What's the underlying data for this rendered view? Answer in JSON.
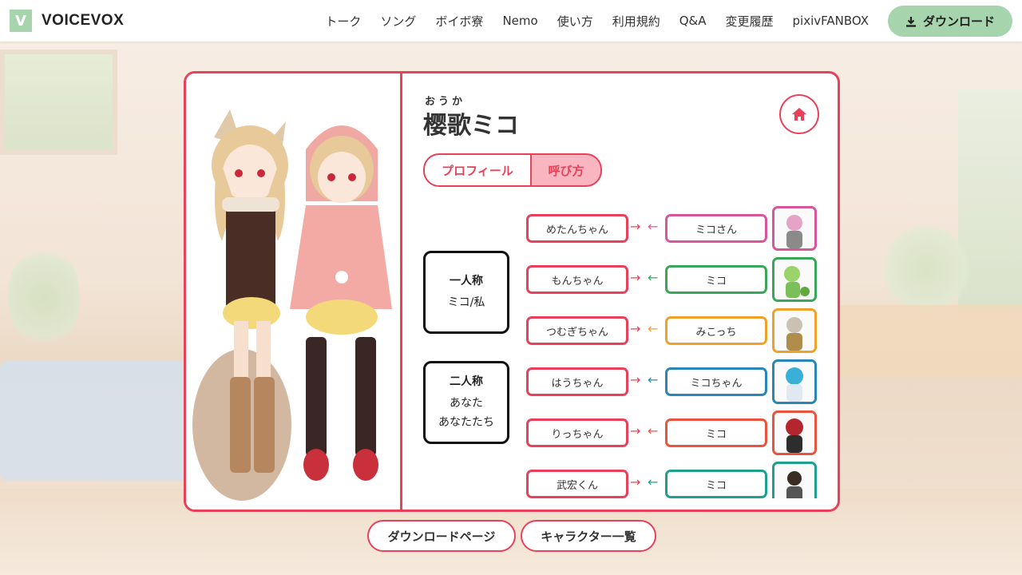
{
  "header": {
    "logo_mark": "V",
    "logo_text": "VOICEVOX",
    "nav": [
      "トーク",
      "ソング",
      "ボイボ寮",
      "Nemo",
      "使い方",
      "利用規約",
      "Q&A",
      "変更履歴",
      "pixivFANBOX"
    ],
    "download_label": "ダウンロード",
    "download_icon": "download-icon",
    "accent": "#a5d4ad"
  },
  "character": {
    "ruby": "おうか",
    "name": "樱歌ミコ",
    "home_icon": "home-icon",
    "accent": "#e8415a"
  },
  "tabs": [
    {
      "label": "プロフィール",
      "selected": false
    },
    {
      "label": "呼び方",
      "selected": true
    }
  ],
  "pronouns": {
    "first_person": {
      "title": "一人称",
      "values": [
        "ミコ/私"
      ]
    },
    "second_person": {
      "title": "二人称",
      "values": [
        "あなた",
        "あなたたち"
      ]
    }
  },
  "relations": [
    {
      "from": "めたんちゃん",
      "to": "ミコさん",
      "color": "#d6579b"
    },
    {
      "from": "もんちゃん",
      "to": "ミコ",
      "color": "#3aa65a"
    },
    {
      "from": "つむぎちゃん",
      "to": "みこっち",
      "color": "#efa22b"
    },
    {
      "from": "はうちゃん",
      "to": "ミコちゃん",
      "color": "#2b86b8"
    },
    {
      "from": "りっちゃん",
      "to": "ミコ",
      "color": "#e8553f"
    },
    {
      "from": "武宏くん",
      "to": "ミコ",
      "color": "#1fa08f"
    }
  ],
  "bottom": {
    "download_page": "ダウンロードページ",
    "character_list": "キャラクター一覧"
  }
}
